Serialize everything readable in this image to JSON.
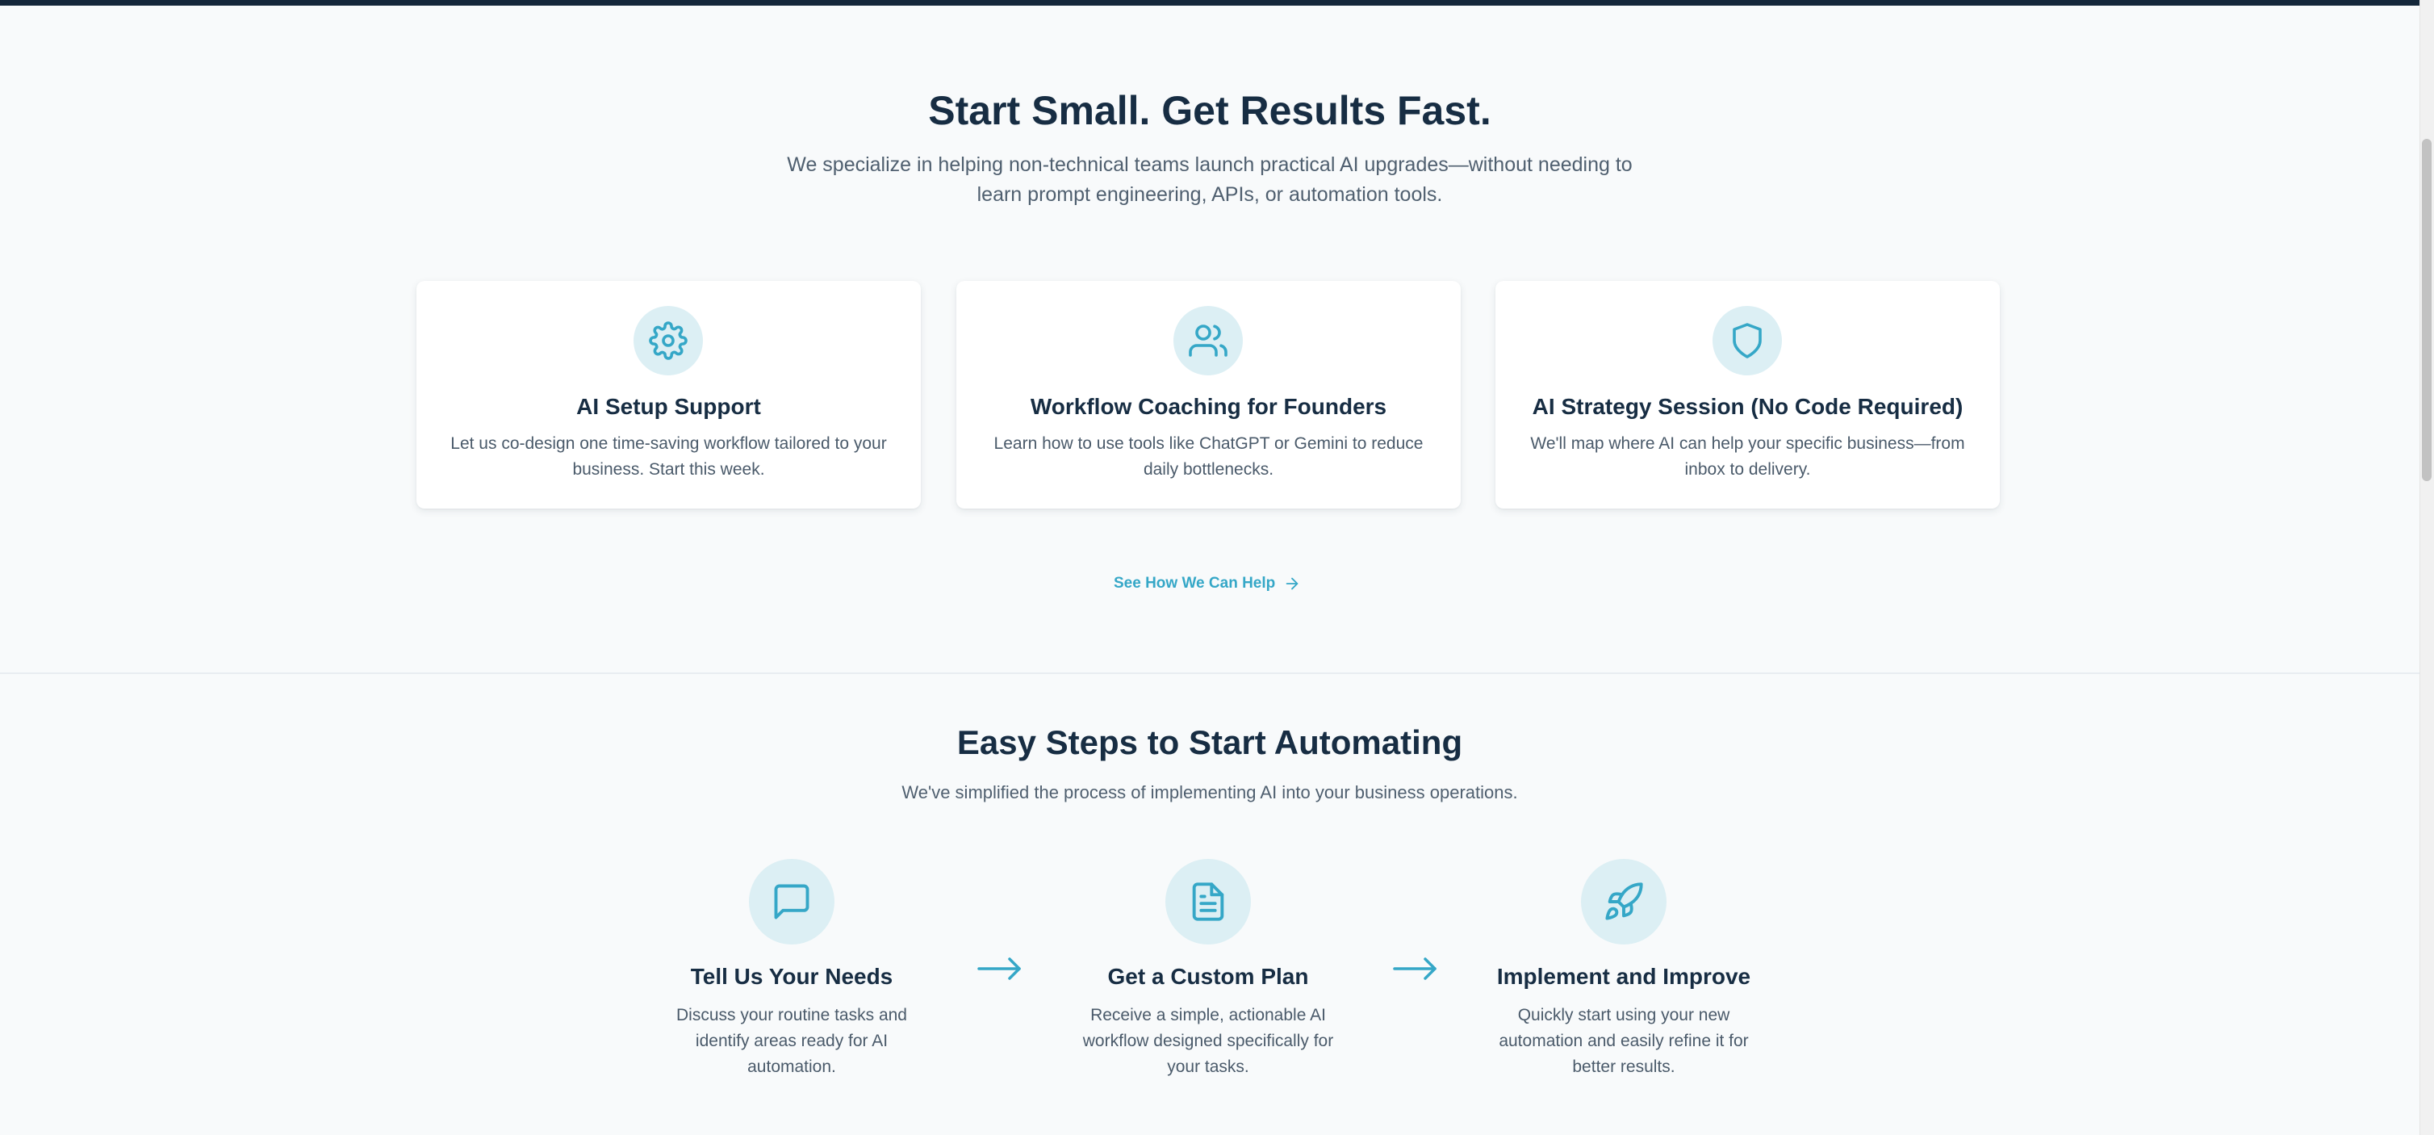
{
  "hero": {
    "title": "Start Small. Get Results Fast.",
    "subtitle": "We specialize in helping non-technical teams launch practical AI upgrades—without needing to learn prompt engineering, APIs, or automation tools."
  },
  "services": [
    {
      "icon": "gear-icon",
      "title": "AI Setup Support",
      "description": "Let us co-design one time-saving workflow tailored to your business. Start this week."
    },
    {
      "icon": "users-icon",
      "title": "Workflow Coaching for Founders",
      "description": "Learn how to use tools like ChatGPT or Gemini to reduce daily bottlenecks."
    },
    {
      "icon": "shield-icon",
      "title": "AI Strategy Session (No Code Required)",
      "description": "We'll map where AI can help your specific business—from inbox to delivery."
    }
  ],
  "help_link": {
    "label": "See How We Can Help",
    "icon": "arrow-right-icon"
  },
  "steps_section": {
    "title": "Easy Steps to Start Automating",
    "subtitle": "We've simplified the process of implementing AI into your business operations.",
    "steps": [
      {
        "icon": "chat-bubble-icon",
        "title": "Tell Us Your Needs",
        "description": "Discuss your routine tasks and identify areas ready for AI automation."
      },
      {
        "icon": "document-icon",
        "title": "Get a Custom Plan",
        "description": "Receive a simple, actionable AI workflow designed specifically for your tasks."
      },
      {
        "icon": "rocket-icon",
        "title": "Implement and Improve",
        "description": "Quickly start using your new automation and easily refine it for better results."
      }
    ]
  },
  "colors": {
    "accent": "#35a7c7",
    "icon_background": "#dceff4",
    "heading": "#172d43",
    "body_text": "#4a5a6a",
    "page_background": "#f8fafb",
    "top_bar": "#14273a"
  }
}
